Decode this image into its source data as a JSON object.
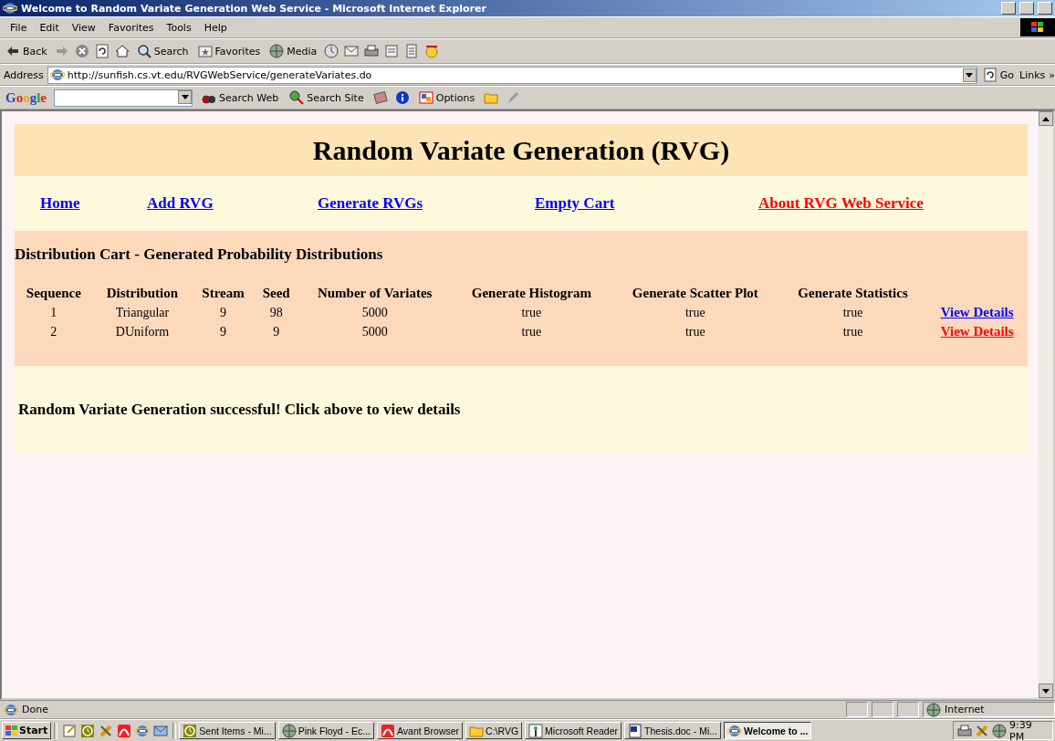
{
  "window": {
    "title": "Welcome to Random Variate Generation Web Service - Microsoft Internet Explorer"
  },
  "menu": [
    {
      "label": "File"
    },
    {
      "label": "Edit"
    },
    {
      "label": "View"
    },
    {
      "label": "Favorites"
    },
    {
      "label": "Tools"
    },
    {
      "label": "Help"
    }
  ],
  "toolbar": [
    {
      "kind": "back",
      "label": "Back"
    },
    {
      "kind": "forward"
    },
    {
      "kind": "stop"
    },
    {
      "kind": "refresh"
    },
    {
      "kind": "home"
    },
    {
      "kind": "search",
      "label": "Search"
    },
    {
      "kind": "favorites",
      "label": "Favorites"
    },
    {
      "kind": "media",
      "label": "Media"
    },
    {
      "kind": "history"
    },
    {
      "kind": "mail"
    },
    {
      "kind": "print"
    },
    {
      "kind": "edit"
    },
    {
      "kind": "discuss"
    },
    {
      "kind": "messenger"
    }
  ],
  "address": {
    "label": "Address",
    "value": "http://sunfish.cs.vt.edu/RVGWebService/generateVariates.do",
    "go": "Go",
    "links": "Links",
    "more": "»"
  },
  "google_bar": {
    "logo": "Google",
    "items": [
      {
        "kind": "search-web",
        "label": "Search Web"
      },
      {
        "kind": "search-site",
        "label": "Search Site"
      },
      {
        "kind": "news"
      },
      {
        "kind": "info"
      },
      {
        "kind": "options",
        "label": "Options"
      },
      {
        "kind": "folder"
      },
      {
        "kind": "pen"
      }
    ]
  },
  "page": {
    "heading": "Random Variate Generation (RVG)",
    "nav": [
      {
        "label": "Home",
        "visited": false
      },
      {
        "label": "Add RVG",
        "visited": false
      },
      {
        "label": "Generate RVGs",
        "visited": false
      },
      {
        "label": "Empty Cart",
        "visited": false
      },
      {
        "label": "About RVG Web Service",
        "visited": true
      }
    ],
    "cart_title": "Distribution Cart - Generated Probability Distributions",
    "table": {
      "columns": [
        "Sequence",
        "Distribution",
        "Stream",
        "Seed",
        "Number of Variates",
        "Generate Histogram",
        "Generate Scatter Plot",
        "Generate Statistics"
      ],
      "rows": [
        {
          "cells": [
            "1",
            "Triangular",
            "9",
            "98",
            "5000",
            "true",
            "true",
            "true"
          ],
          "link": {
            "label": "View Details",
            "visited": false
          }
        },
        {
          "cells": [
            "2",
            "DUniform",
            "9",
            "9",
            "5000",
            "true",
            "true",
            "true"
          ],
          "link": {
            "label": "View Details",
            "visited": true
          }
        }
      ]
    },
    "message": "Random Variate Generation successful! Click above to view details"
  },
  "status_bar": {
    "text": "Done",
    "zone": "Internet"
  },
  "taskbar": {
    "start": "Start",
    "quick_launch": [
      {
        "kind": "notepad"
      },
      {
        "kind": "clock"
      },
      {
        "kind": "tools"
      },
      {
        "kind": "avant"
      },
      {
        "kind": "ie"
      },
      {
        "kind": "outlook"
      }
    ],
    "tasks": [
      {
        "kind": "clock",
        "label": "Sent Items - Mi...",
        "selected": false
      },
      {
        "kind": "media",
        "label": "Pink Floyd - Ec...",
        "selected": false
      },
      {
        "kind": "avant",
        "label": "Avant Browser",
        "selected": false
      },
      {
        "kind": "folder",
        "label": "C:\\RVG",
        "selected": false
      },
      {
        "kind": "reader",
        "label": "Microsoft Reader",
        "selected": false
      },
      {
        "kind": "word",
        "label": "Thesis.doc - Mi...",
        "selected": false
      },
      {
        "kind": "ie",
        "label": "Welcome to ...",
        "selected": true
      }
    ],
    "clock": "9:39 PM"
  }
}
